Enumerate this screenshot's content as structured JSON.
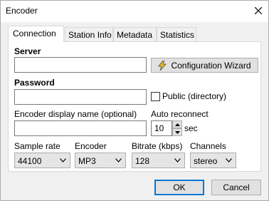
{
  "window": {
    "title": "Encoder"
  },
  "tabs": [
    {
      "label": "Connection",
      "active": true
    },
    {
      "label": "Station Info",
      "active": false
    },
    {
      "label": "Metadata",
      "active": false
    },
    {
      "label": "Statistics",
      "active": false
    }
  ],
  "connection": {
    "server_label": "Server",
    "server_value": "",
    "config_wizard_label": "Configuration Wizard",
    "password_label": "Password",
    "password_value": "",
    "public_label": "Public (directory)",
    "public_checked": false,
    "display_name_label": "Encoder display name (optional)",
    "display_name_value": "",
    "auto_reconnect_label": "Auto reconnect",
    "auto_reconnect_value": "10",
    "auto_reconnect_unit": "sec",
    "sample_rate_label": "Sample rate",
    "sample_rate_value": "44100",
    "encoder_label": "Encoder",
    "encoder_value": "MP3",
    "bitrate_label": "Bitrate (kbps)",
    "bitrate_value": "128",
    "channels_label": "Channels",
    "channels_value": "stereo"
  },
  "footer": {
    "ok_label": "OK",
    "cancel_label": "Cancel"
  },
  "colors": {
    "accent": "#0078d7",
    "wizard_icon": "#e8c21a"
  },
  "icons": {
    "close": "close-icon",
    "wizard": "lightning-icon",
    "dropdown": "chevron-down-icon"
  }
}
